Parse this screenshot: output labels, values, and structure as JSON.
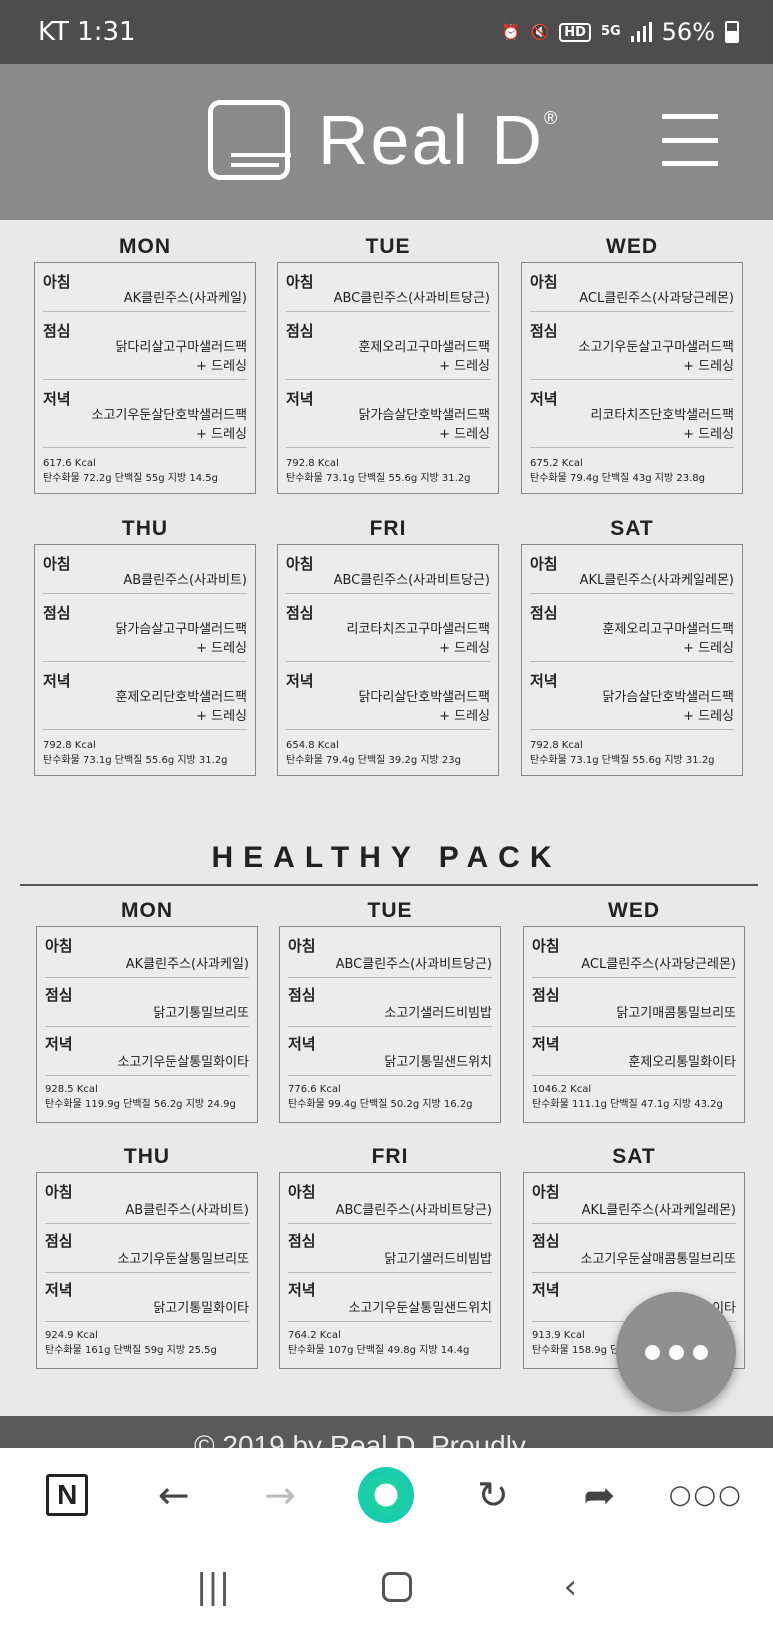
{
  "status": {
    "carrier_time": "KT 1:31",
    "hd": "HD",
    "g5": "5G",
    "battery": "56%"
  },
  "header": {
    "brand": "Real D",
    "reg": "®"
  },
  "plan1": [
    {
      "day": "MON",
      "breakfast": "AK클린주스(사과케일)",
      "lunch": "닭다리살고구마샐러드팩",
      "lunch2": "+ 드레싱",
      "dinner": "소고기우둔살단호박샐러드팩",
      "dinner2": "+ 드레싱",
      "kcal": "617.6 Kcal",
      "macros": "탄수화물 72.2g 단백질 55g 지방 14.5g"
    },
    {
      "day": "TUE",
      "breakfast": "ABC클린주스(사과비트당근)",
      "lunch": "훈제오리고구마샐러드팩",
      "lunch2": "+ 드레싱",
      "dinner": "닭가슴살단호박샐러드팩",
      "dinner2": "+ 드레싱",
      "kcal": "792.8 Kcal",
      "macros": "탄수화물 73.1g 단백질 55.6g 지방 31.2g"
    },
    {
      "day": "WED",
      "breakfast": "ACL클린주스(사과당근레몬)",
      "lunch": "소고기우둔살고구마샐러드팩",
      "lunch2": "+ 드레싱",
      "dinner": "리코타치즈단호박샐러드팩",
      "dinner2": "+ 드레싱",
      "kcal": "675.2 Kcal",
      "macros": "탄수화물 79.4g 단백질 43g 지방 23.8g"
    },
    {
      "day": "THU",
      "breakfast": "AB클린주스(사과비트)",
      "lunch": "닭가슴살고구마샐러드팩",
      "lunch2": "+ 드레싱",
      "dinner": "훈제오리단호박샐러드팩",
      "dinner2": "+ 드레싱",
      "kcal": "792.8 Kcal",
      "macros": "탄수화물 73.1g 단백질 55.6g 지방 31.2g"
    },
    {
      "day": "FRI",
      "breakfast": "ABC클린주스(사과비트당근)",
      "lunch": "리코타치즈고구마샐러드팩",
      "lunch2": "+ 드레싱",
      "dinner": "닭다리살단호박샐러드팩",
      "dinner2": "+ 드레싱",
      "kcal": "654.8 Kcal",
      "macros": "탄수화물 79.4g 단백질 39.2g 지방 23g"
    },
    {
      "day": "SAT",
      "breakfast": "AKL클린주스(사과케일레몬)",
      "lunch": "훈제오리고구마샐러드팩",
      "lunch2": "+ 드레싱",
      "dinner": "닭가슴살단호박샐러드팩",
      "dinner2": "+ 드레싱",
      "kcal": "792.8 Kcal",
      "macros": "탄수화물 73.1g 단백질 55.6g 지방 31.2g"
    }
  ],
  "labels": {
    "breakfast": "아침",
    "lunch": "점심",
    "dinner": "저녁"
  },
  "healthy": {
    "title": "HEALTHY PACK",
    "days": [
      {
        "day": "MON",
        "breakfast": "AK클린주스(사과케일)",
        "lunch": "닭고기통밀브리또",
        "dinner": "소고기우둔살통밀화이타",
        "kcal": "928.5 Kcal",
        "macros": "탄수화물 119.9g 단백질 56.2g 지방 24.9g"
      },
      {
        "day": "TUE",
        "breakfast": "ABC클린주스(사과비트당근)",
        "lunch": "소고기샐러드비빔밥",
        "dinner": "닭고기통밀샌드위치",
        "kcal": "776.6 Kcal",
        "macros": "탄수화물 99.4g 단백질 50.2g 지방 16.2g"
      },
      {
        "day": "WED",
        "breakfast": "ACL클린주스(사과당근레몬)",
        "lunch": "닭고기매콤통밀브리또",
        "dinner": "훈제오리통밀화이타",
        "kcal": "1046.2 Kcal",
        "macros": "탄수화물 111.1g 단백질 47.1g 지방 43.2g"
      },
      {
        "day": "THU",
        "breakfast": "AB클린주스(사과비트)",
        "lunch": "소고기우둔살통밀브리또",
        "dinner": "닭고기통밀화이타",
        "kcal": "924.9 Kcal",
        "macros": "탄수화물 161g 단백질 59g 지방 25.5g"
      },
      {
        "day": "FRI",
        "breakfast": "ABC클린주스(사과비트당근)",
        "lunch": "닭고기샐러드비빔밥",
        "dinner": "소고기우둔살통밀샌드위치",
        "kcal": "764.2 Kcal",
        "macros": "탄수화물 107g 단백질 49.8g 지방 14.4g"
      },
      {
        "day": "SAT",
        "breakfast": "AKL클린주스(사과케일레몬)",
        "lunch": "소고기우둔살매콤통밀브리또",
        "dinner": "이타",
        "kcal": "913.9 Kcal",
        "macros": "탄수화물 158.9g 단"
      }
    ]
  },
  "footer": {
    "text": "© 2019 by Real D. Proudly"
  },
  "browser": {
    "n_label": "N"
  }
}
